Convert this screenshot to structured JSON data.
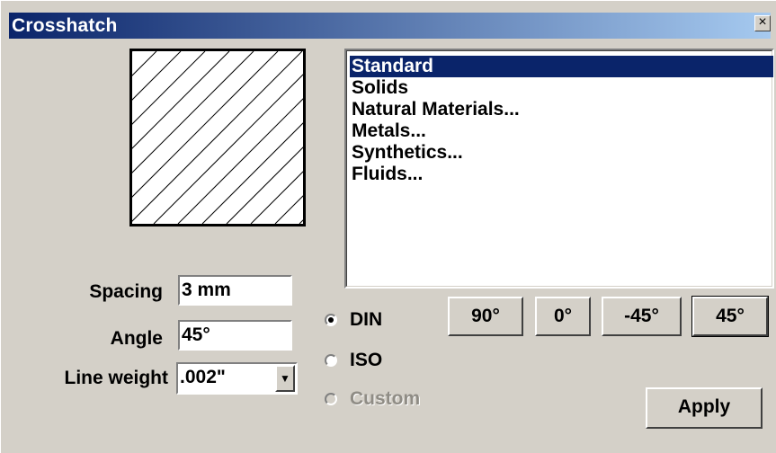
{
  "window": {
    "title": "Crosshatch",
    "close_glyph": "×"
  },
  "preview": {
    "pattern": "diagonal-hatch-45"
  },
  "pattern_list": {
    "items": [
      "Standard",
      "Solids",
      "Natural Materials...",
      "Metals...",
      "Synthetics...",
      "Fluids..."
    ],
    "selected_index": 0
  },
  "fields": {
    "spacing": {
      "label": "Spacing",
      "value": "3 mm"
    },
    "angle": {
      "label": "Angle",
      "value": "45°"
    },
    "line_weight": {
      "label": "Line weight",
      "value": ".002\"",
      "dropdown_glyph": "▼"
    }
  },
  "standard": {
    "options": [
      {
        "label": "DIN",
        "checked": true,
        "enabled": true
      },
      {
        "label": "ISO",
        "checked": false,
        "enabled": true
      },
      {
        "label": "Custom",
        "checked": false,
        "enabled": false
      }
    ]
  },
  "angle_buttons": [
    "90°",
    "0°",
    "-45°",
    "45°"
  ],
  "apply_label": "Apply"
}
